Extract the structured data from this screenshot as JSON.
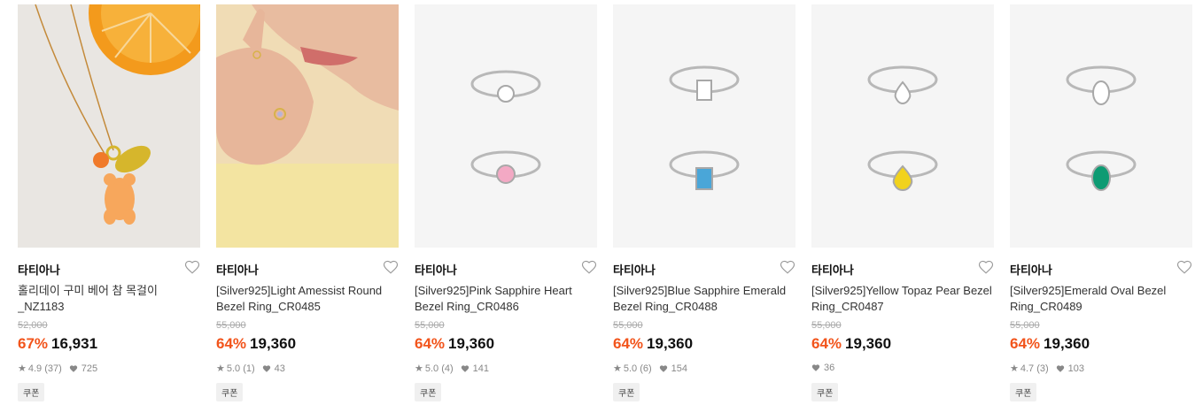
{
  "products": [
    {
      "brand": "타티아나",
      "name": "홀리데이 구미 베어 참 목걸이 _NZ1183",
      "original_price": "52,000",
      "discount": "67%",
      "price": "16,931",
      "rating": "4.9 (37)",
      "likes": "725",
      "coupon": "쿠폰",
      "image": "necklace-photo"
    },
    {
      "brand": "타티아나",
      "name": "[Silver925]Light Amessist Round Bezel Ring_CR0485",
      "original_price": "55,000",
      "discount": "64%",
      "price": "19,360",
      "rating": "5.0 (1)",
      "likes": "43",
      "coupon": "쿠폰",
      "image": "model-hand-photo"
    },
    {
      "brand": "타티아나",
      "name": "[Silver925]Pink Sapphire Heart Bezel Ring_CR0486",
      "original_price": "55,000",
      "discount": "64%",
      "price": "19,360",
      "rating": "5.0 (4)",
      "likes": "141",
      "coupon": "쿠폰",
      "image": "ring-photo",
      "gem_color": "#f3a9c4"
    },
    {
      "brand": "타티아나",
      "name": "[Silver925]Blue Sapphire Emerald Bezel Ring_CR0488",
      "original_price": "55,000",
      "discount": "64%",
      "price": "19,360",
      "rating": "5.0 (6)",
      "likes": "154",
      "coupon": "쿠폰",
      "image": "ring-photo",
      "gem_color": "#4aa6d8"
    },
    {
      "brand": "타티아나",
      "name": "[Silver925]Yellow Topaz Pear Bezel Ring_CR0487",
      "original_price": "55,000",
      "discount": "64%",
      "price": "19,360",
      "rating": "",
      "likes": "36",
      "coupon": "쿠폰",
      "image": "ring-photo",
      "gem_color": "#f1d21c"
    },
    {
      "brand": "타티아나",
      "name": "[Silver925]Emerald Oval Bezel Ring_CR0489",
      "original_price": "55,000",
      "discount": "64%",
      "price": "19,360",
      "rating": "4.7 (3)",
      "likes": "103",
      "coupon": "쿠폰",
      "image": "ring-photo",
      "gem_color": "#0e9b73"
    }
  ],
  "colors": {
    "discount": "#f2541b",
    "image_bg": "#f5f5f5"
  }
}
